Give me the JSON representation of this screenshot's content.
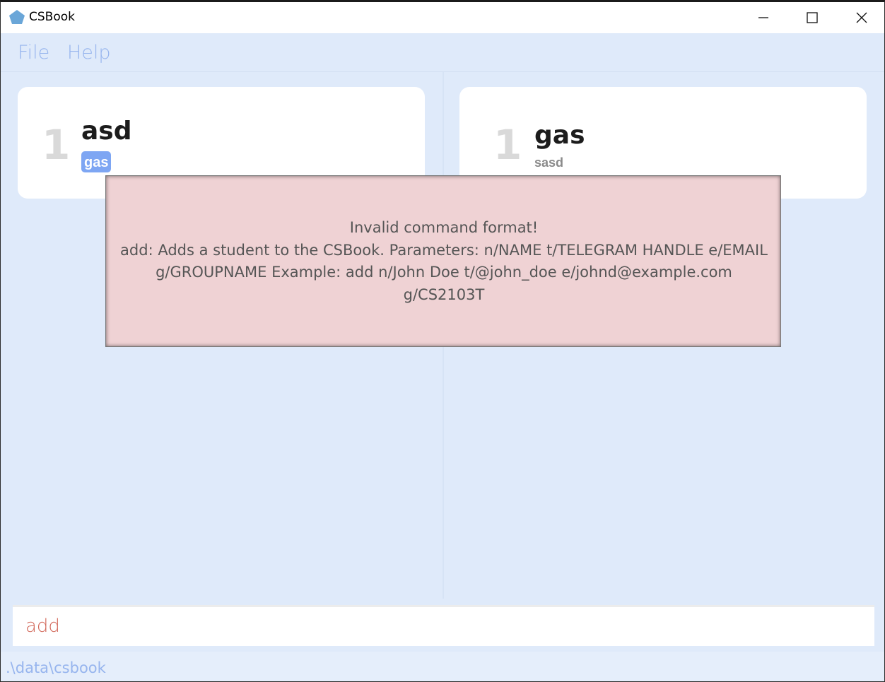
{
  "window": {
    "title": "CSBook",
    "icon": "pentagon-app-icon",
    "controls": [
      "minimize-icon",
      "maximize-icon",
      "close-icon"
    ]
  },
  "menu": {
    "file_label": "File",
    "help_label": "Help"
  },
  "student_list": {
    "cards": [
      {
        "index": "1",
        "name": "asd",
        "tag": "gas"
      }
    ]
  },
  "group_list": {
    "cards": [
      {
        "index": "1",
        "name": "gas",
        "subtitle": "sasd"
      }
    ]
  },
  "error_popup": {
    "line1": "Invalid command format!",
    "line2": "add: Adds a student to the CSBook. Parameters: n/NAME t/TELEGRAM HANDLE e/EMAIL",
    "line3": "g/GROUPNAME Example: add n/John Doe t/@john_doe e/johnd@example.com",
    "line4": "g/CS2103T"
  },
  "command": {
    "value": "add"
  },
  "status_bar": {
    "path": ".\\data\\csbook"
  },
  "colors": {
    "background": "#dfeafa",
    "accent": "#97b5ee",
    "tag": "#7ea6f3",
    "error_bg": "#efd2d4",
    "command_text": "#d2685a"
  }
}
